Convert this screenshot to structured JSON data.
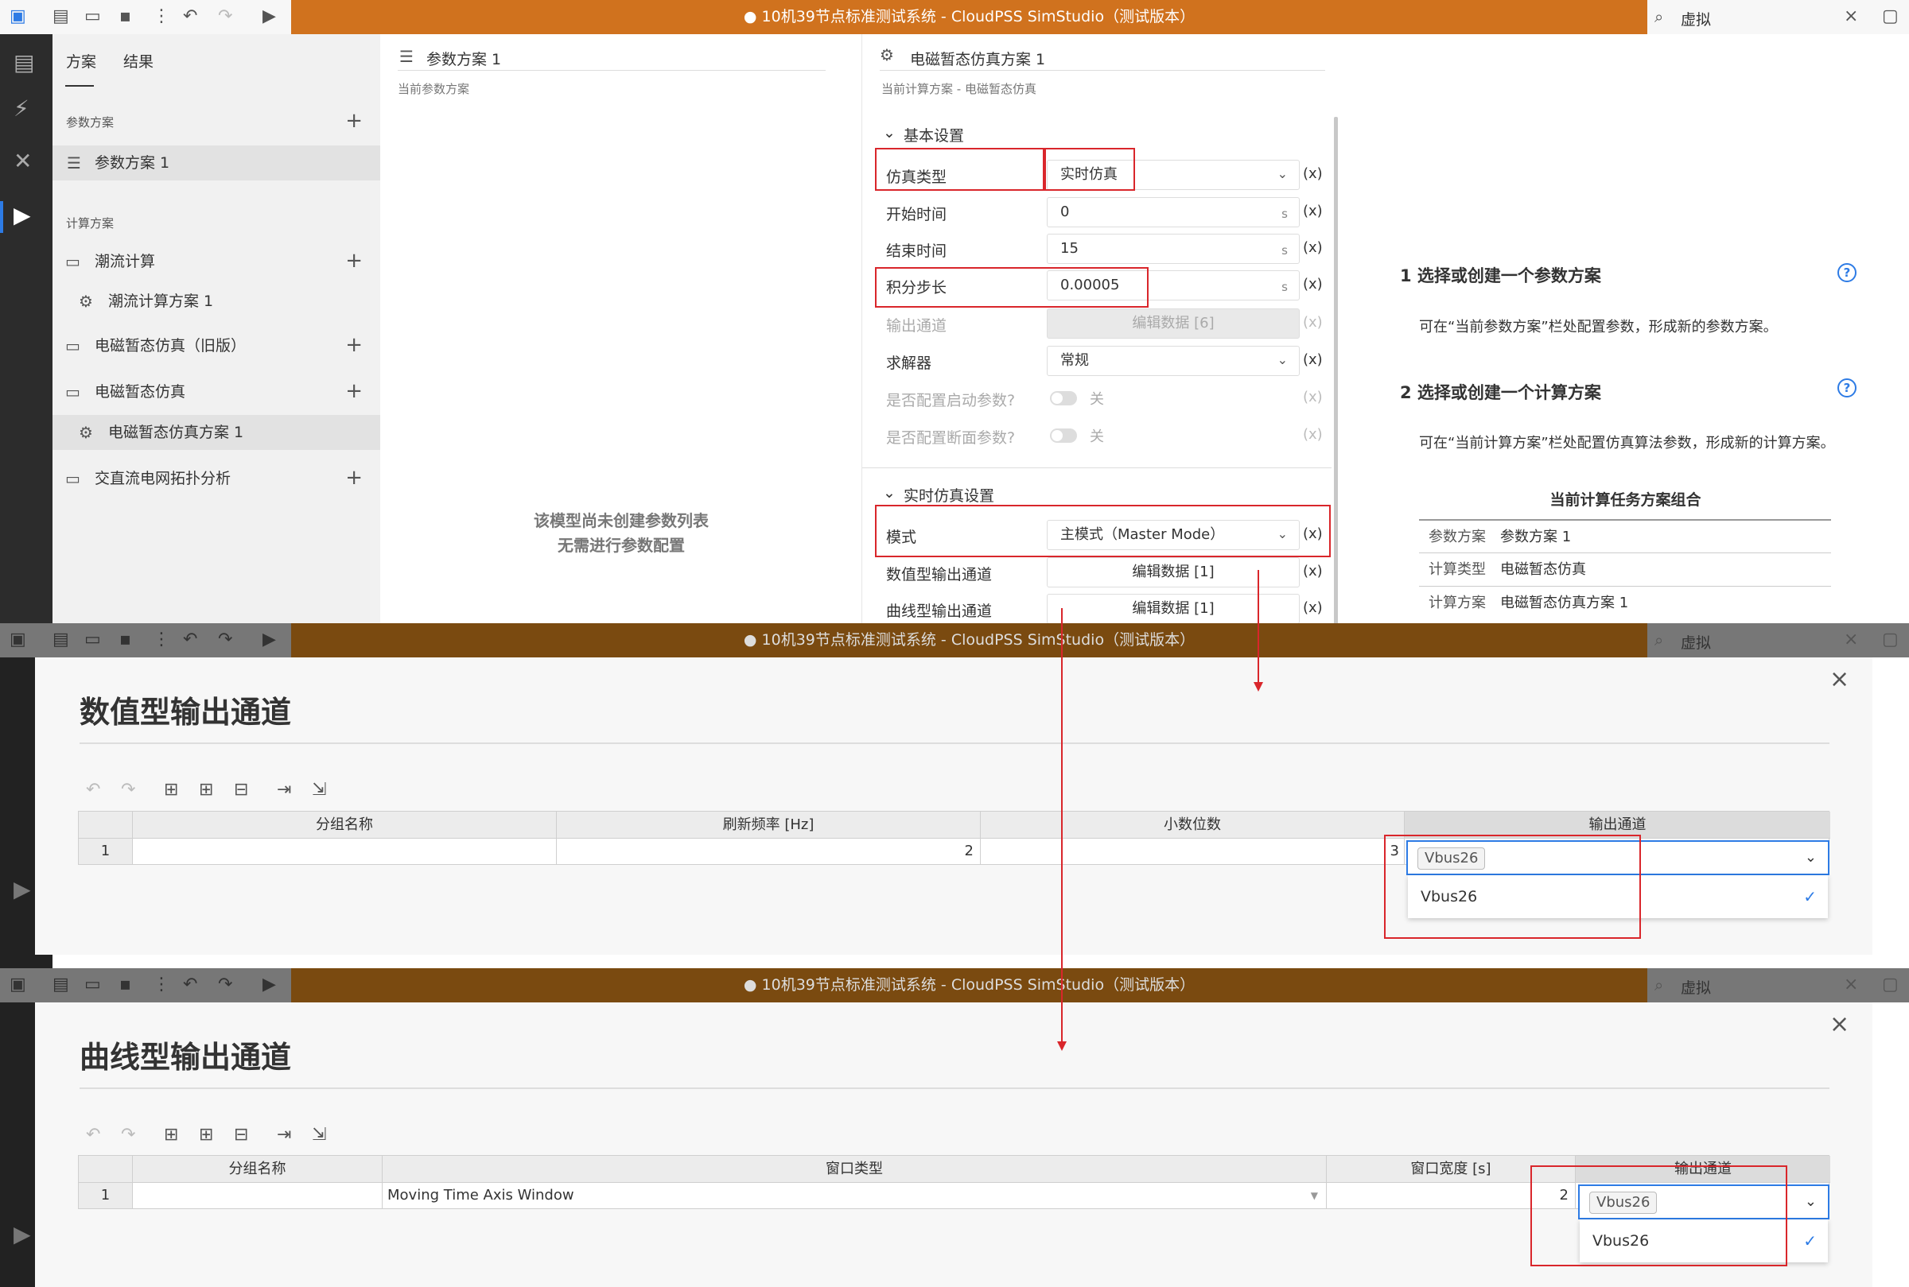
{
  "titlebar": {
    "title": "● 10机39节点标准测试系统 - CloudPSS SimStudio（测试版本）",
    "search_placeholder": "虚拟",
    "close": "×"
  },
  "sidebar": {
    "tabs": [
      "方案",
      "结果"
    ],
    "param_section": "参数方案",
    "param_item": "参数方案 1",
    "calc_section": "计算方案",
    "items": [
      "潮流计算",
      "潮流计算方案 1",
      "电磁暂态仿真（旧版）",
      "电磁暂态仿真",
      "电磁暂态仿真方案 1",
      "交直流电网拓扑分析"
    ]
  },
  "param_pane": {
    "title": "参数方案 1",
    "subtitle": "当前参数方案",
    "empty_line1": "该模型尚未创建参数列表",
    "empty_line2": "无需进行参数配置"
  },
  "sim_pane": {
    "title": "电磁暂态仿真方案 1",
    "subtitle": "当前计算方案 - 电磁暂态仿真",
    "basic_group": "基本设置",
    "rt_group": "实时仿真设置",
    "x_mark": "(x)",
    "unit_s": "s",
    "fields": {
      "sim_type_label": "仿真类型",
      "sim_type_value": "实时仿真",
      "start_label": "开始时间",
      "start_value": "0",
      "end_label": "结束时间",
      "end_value": "15",
      "step_label": "积分步长",
      "step_value": "0.00005",
      "out_label": "输出通道",
      "out_value": "编辑数据 [6]",
      "solver_label": "求解器",
      "solver_value": "常规",
      "init_label": "是否配置启动参数?",
      "init_value": "关",
      "snap_label": "是否配置断面参数?",
      "snap_value": "关",
      "mode_label": "模式",
      "mode_value": "主模式（Master Mode）",
      "num_out_label": "数值型输出通道",
      "num_out_value": "编辑数据 [1]",
      "curve_out_label": "曲线型输出通道",
      "curve_out_value": "编辑数据 [1]"
    }
  },
  "right_pane": {
    "step1_title": "1  选择或创建一个参数方案",
    "step1_desc": "可在“当前参数方案”栏处配置参数，形成新的参数方案。",
    "step2_title": "2  选择或创建一个计算方案",
    "step2_desc": "可在“当前计算方案”栏处配置仿真算法参数，形成新的计算方案。",
    "combo_title": "当前计算任务方案组合",
    "combo": [
      {
        "k": "参数方案",
        "v": "参数方案 1"
      },
      {
        "k": "计算类型",
        "v": "电磁暂态仿真"
      },
      {
        "k": "计算方案",
        "v": "电磁暂态仿真方案 1"
      }
    ]
  },
  "dialog_numeric": {
    "title": "数值型输出通道",
    "headers": [
      "分组名称",
      "刷新频率 [Hz]",
      "小数位数",
      "输出通道"
    ],
    "row": {
      "index": "1",
      "name": "",
      "freq": "2",
      "decimals": "3",
      "channel": "Vbus26"
    },
    "option": "Vbus26"
  },
  "dialog_curve": {
    "title": "曲线型输出通道",
    "headers": [
      "分组名称",
      "窗口类型",
      "窗口宽度 [s]",
      "输出通道"
    ],
    "row": {
      "index": "1",
      "name": "",
      "window_type": "Moving Time Axis Window",
      "width": "2",
      "channel": "Vbus26"
    },
    "option": "Vbus26"
  },
  "colors": {
    "title_bar": "#d0721e",
    "accent": "#2d7be5",
    "highlight": "#d9262b"
  }
}
